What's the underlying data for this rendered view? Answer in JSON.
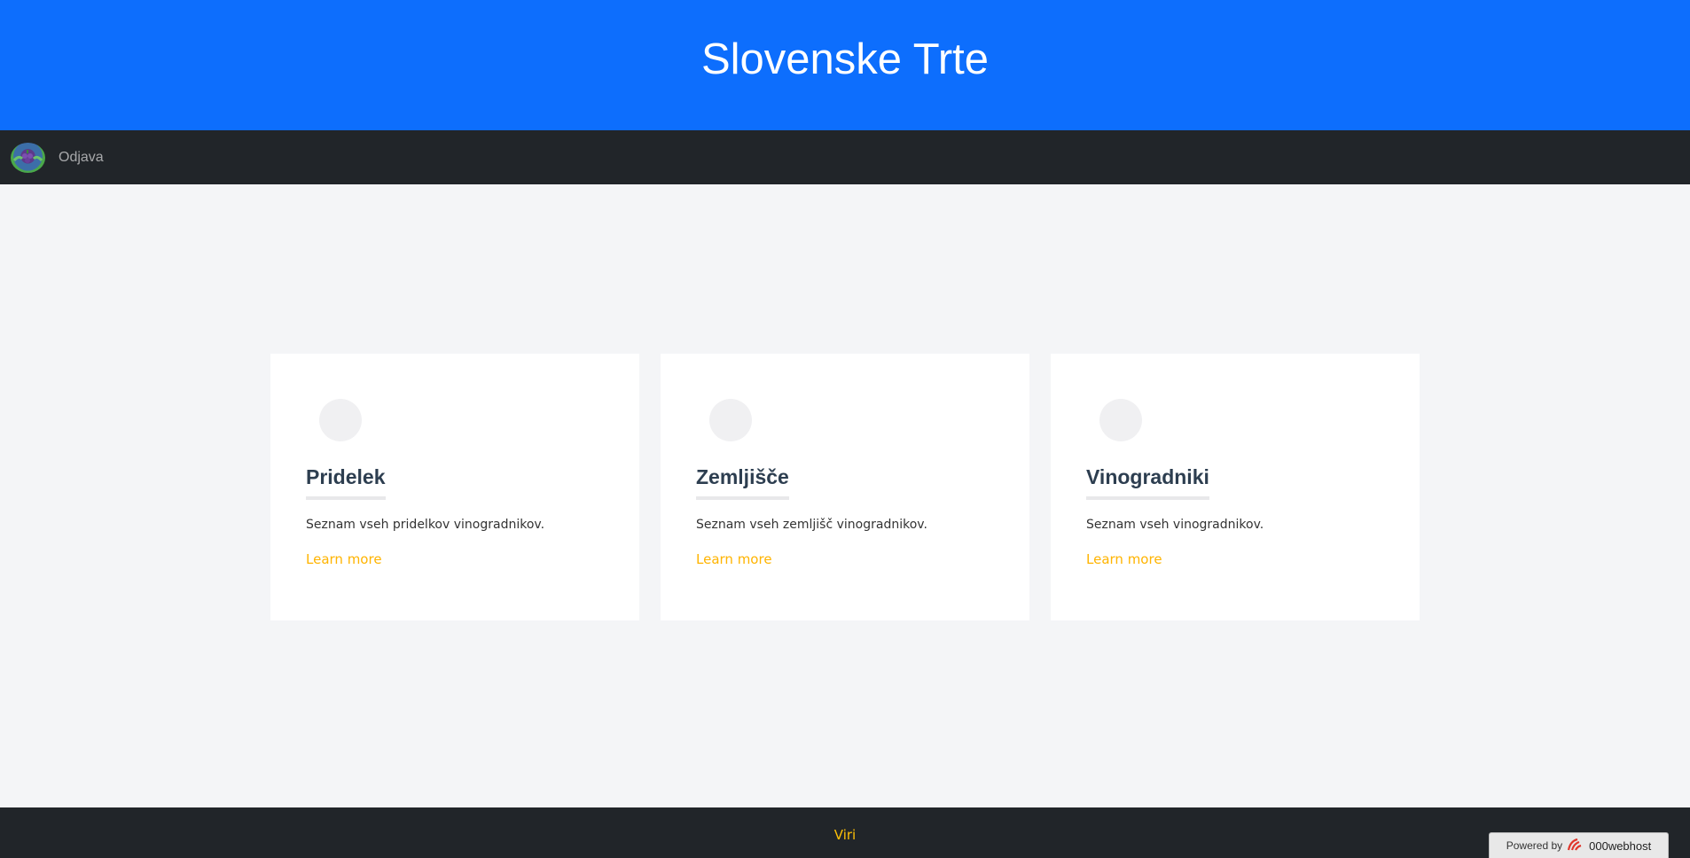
{
  "header": {
    "title": "Slovenske Trte"
  },
  "navbar": {
    "logo_icon": "grape-logo-icon",
    "logout_label": "Odjava"
  },
  "cards": [
    {
      "title": "Pridelek",
      "text": "Seznam vseh pridelkov vinogradnikov.",
      "link": "Learn more"
    },
    {
      "title": "Zemljišče",
      "text": "Seznam vseh zemljišč vinogradnikov.",
      "link": "Learn more"
    },
    {
      "title": "Vinogradniki",
      "text": "Seznam vseh vinogradnikov.",
      "link": "Learn more"
    }
  ],
  "footer": {
    "link": "Viri"
  },
  "badge": {
    "powered_by": "Powered by",
    "brand": "000webhost"
  },
  "colors": {
    "primary": "#0d6efd",
    "dark": "#212529",
    "accent": "#ffc107",
    "background": "#f4f5f7"
  }
}
